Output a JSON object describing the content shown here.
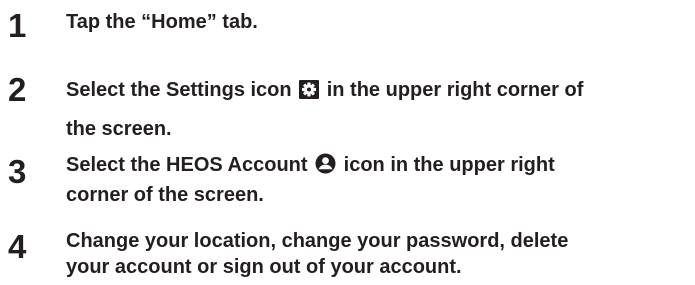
{
  "steps": [
    {
      "number": "1",
      "lines": [
        "Tap the “Home” tab."
      ]
    },
    {
      "number": "2",
      "before_icon": "Select the Settings icon",
      "icon": "gear-icon",
      "after_icon": "in the upper right corner of",
      "line2": "the screen."
    },
    {
      "number": "3",
      "before_icon": "Select the HEOS Account",
      "icon": "account-icon",
      "after_icon": "icon in the upper right",
      "line2": "corner of the screen."
    },
    {
      "number": "4",
      "lines": [
        "Change your location, change your password, delete",
        "your account or sign out of your account."
      ]
    }
  ]
}
